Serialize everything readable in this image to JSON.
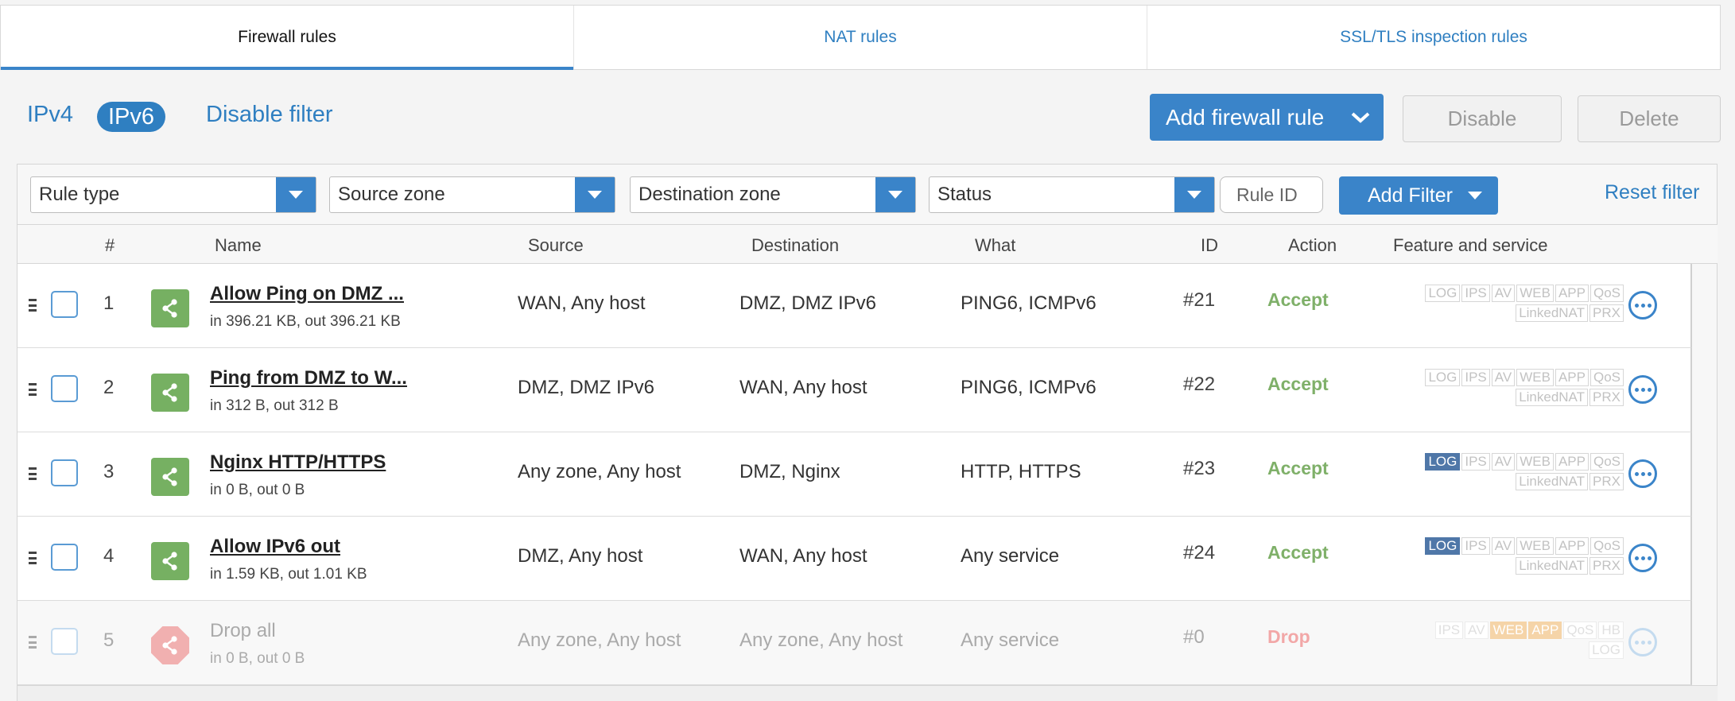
{
  "tabs": [
    {
      "label": "Firewall rules",
      "active": true
    },
    {
      "label": "NAT rules",
      "active": false
    },
    {
      "label": "SSL/TLS inspection rules",
      "active": false
    }
  ],
  "toolbar": {
    "ipv4": "IPv4",
    "ipv6": "IPv6",
    "disable_filter": "Disable filter",
    "add_rule": "Add firewall rule",
    "disable": "Disable",
    "delete": "Delete"
  },
  "filters": {
    "rule_type": "Rule type",
    "source_zone": "Source zone",
    "destination_zone": "Destination zone",
    "status": "Status",
    "rule_id_placeholder": "Rule ID",
    "add_filter": "Add Filter",
    "reset_filter": "Reset filter"
  },
  "columns": {
    "num": "#",
    "name": "Name",
    "source": "Source",
    "destination": "Destination",
    "what": "What",
    "id": "ID",
    "action": "Action",
    "feature": "Feature and service"
  },
  "rules": [
    {
      "num": "1",
      "name": "Allow Ping on DMZ ...",
      "traffic": "in 396.21 KB, out 396.21 KB",
      "source": "WAN, Any host",
      "destination": "DMZ, DMZ IPv6",
      "what": "PING6, ICMPv6",
      "id": "#21",
      "action": "Accept"
    },
    {
      "num": "2",
      "name": "Ping from DMZ to W...",
      "traffic": "in 312 B, out 312 B",
      "source": "DMZ, DMZ IPv6",
      "destination": "WAN, Any host",
      "what": "PING6, ICMPv6",
      "id": "#22",
      "action": "Accept"
    },
    {
      "num": "3",
      "name": "Nginx HTTP/HTTPS",
      "traffic": "in 0 B, out 0 B",
      "source": "Any zone, Any host",
      "destination": "DMZ, Nginx",
      "what": "HTTP, HTTPS",
      "id": "#23",
      "action": "Accept"
    },
    {
      "num": "4",
      "name": "Allow IPv6 out",
      "traffic": "in 1.59 KB, out 1.01 KB",
      "source": "DMZ, Any host",
      "destination": "WAN, Any host",
      "what": "Any service",
      "id": "#24",
      "action": "Accept"
    },
    {
      "num": "5",
      "name": "Drop all",
      "traffic": "in 0 B, out 0 B",
      "source": "Any zone, Any host",
      "destination": "Any zone, Any host",
      "what": "Any service",
      "id": "#0",
      "action": "Drop"
    }
  ],
  "badges": {
    "log": "LOG",
    "ips": "IPS",
    "av": "AV",
    "web": "WEB",
    "app": "APP",
    "qos": "QoS",
    "linkednat": "LinkedNAT",
    "prx": "PRX",
    "hb": "HB"
  },
  "colors": {
    "accent": "#3a84c9",
    "accept": "#7fb069",
    "drop": "#f2a7a7",
    "log_on": "#4f77a8"
  }
}
